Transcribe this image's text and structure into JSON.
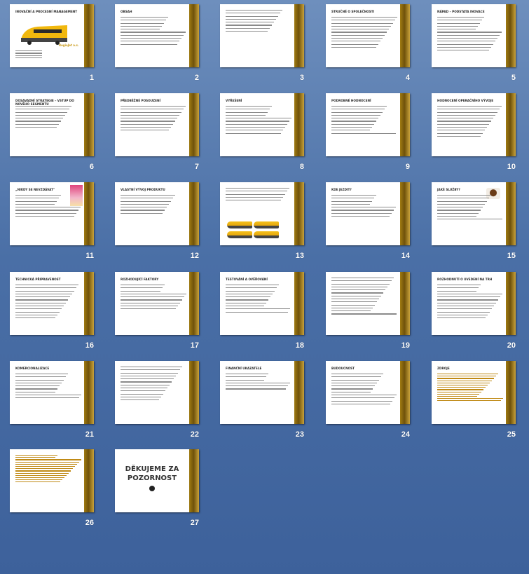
{
  "slides": [
    {
      "n": "1",
      "title": "INOVAČNÍ A PROCESNÍ MANAGEMENT",
      "type": "title",
      "logo": "RegioJet a.s.",
      "lines": 7
    },
    {
      "n": "2",
      "title": "OBSAH",
      "lines": 10
    },
    {
      "n": "3",
      "title": "",
      "lines": 8
    },
    {
      "n": "4",
      "title": "STRUČNĚ O SPOLEČNOSTI",
      "lines": 11
    },
    {
      "n": "5",
      "title": "NÁPAD – PODSTATA INOVACE",
      "lines": 12
    },
    {
      "n": "6",
      "title": "DOSAVADNÍ STRATEGIE – VSTUP DO NOVÉHO SEGMENTU",
      "lines": 8
    },
    {
      "n": "7",
      "title": "PŘEDBĚŽNÉ POSOUZENÍ",
      "lines": 9
    },
    {
      "n": "8",
      "title": "VYŘEŠENÍ",
      "lines": 10
    },
    {
      "n": "9",
      "title": "PODROBNÉ HODNOCENÍ",
      "lines": 10
    },
    {
      "n": "10",
      "title": "HODNOCENÍ OPERAČNÍHO VÝVOJE",
      "lines": 11
    },
    {
      "n": "11",
      "title": "„NIKDY SE NEVZDÁVAT\"",
      "lines": 8,
      "type": "person"
    },
    {
      "n": "12",
      "title": "VLASTNÍ VÝVOJ PRODUKTU",
      "lines": 7
    },
    {
      "n": "13",
      "title": "",
      "lines": 7,
      "type": "trains"
    },
    {
      "n": "14",
      "title": "KDE JEZDIT?",
      "lines": 8
    },
    {
      "n": "15",
      "title": "JAKÉ SLUŽBY?",
      "lines": 9,
      "type": "cup"
    },
    {
      "n": "16",
      "title": "TECHNICKÁ PŘIPRAVENOST",
      "lines": 12
    },
    {
      "n": "17",
      "title": "ROZHODUJÍCÍ FAKTORY",
      "lines": 9
    },
    {
      "n": "18",
      "title": "TESTOVÁNÍ A OVĚŘOVÁNÍ",
      "lines": 10
    },
    {
      "n": "19",
      "title": "",
      "lines": 13
    },
    {
      "n": "20",
      "title": "ROZHODNUTÍ O UVEDENÍ NA TRH",
      "lines": 12
    },
    {
      "n": "21",
      "title": "KOMERCIONALIZACE",
      "lines": 9
    },
    {
      "n": "22",
      "title": "",
      "lines": 12
    },
    {
      "n": "23",
      "title": "FINANČNÍ UKAZATELE",
      "lines": 6
    },
    {
      "n": "24",
      "title": "BUDOUCNOST",
      "lines": 11
    },
    {
      "n": "25",
      "title": "ZDROJE",
      "lines": 13,
      "type": "refs"
    },
    {
      "n": "26",
      "title": "",
      "lines": 13,
      "type": "refs"
    },
    {
      "n": "27",
      "title": "DĚKUJEME ZA POZORNOST",
      "type": "thanks",
      "lines": 0
    }
  ]
}
